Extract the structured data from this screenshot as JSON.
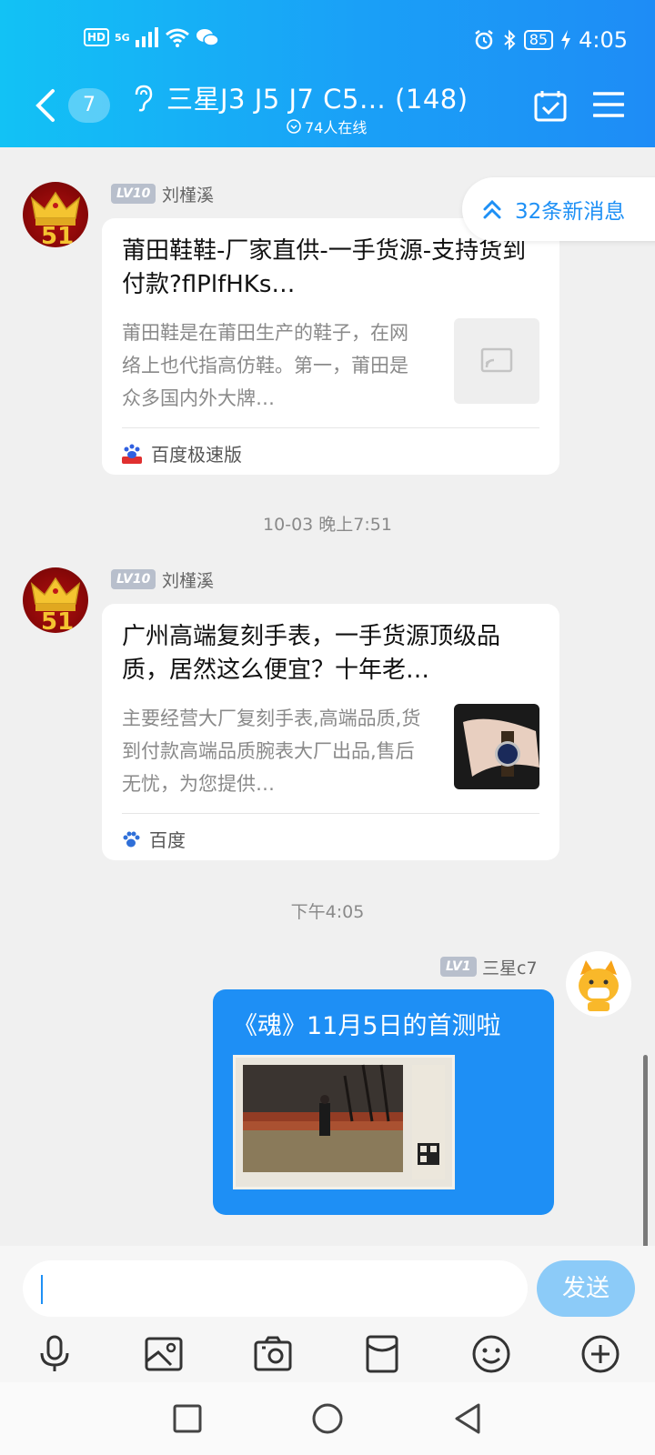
{
  "status_bar": {
    "network_hd": "HD",
    "network_5g": "5G",
    "battery": "85",
    "time": "4:05"
  },
  "header": {
    "back_count": "7",
    "title": "三星J3 J5 J7 C5… (148)",
    "online": "74人在线"
  },
  "new_messages": "32条新消息",
  "messages": [
    {
      "level": "LV10",
      "sender": "刘槿溪",
      "card_title": "莆田鞋鞋-厂家直供-一手货源-支持货到付款?flPlfHKs…",
      "card_desc": "莆田鞋是在莆田生产的鞋子，在网络上也代指高仿鞋。第一，莆田是众多国内外大牌…",
      "source": "百度极速版"
    },
    {
      "timestamp": "10-03 晚上7:51",
      "level": "LV10",
      "sender": "刘槿溪",
      "card_title": "广州高端复刻手表，一手货源顶级品质，居然这么便宜？十年老…",
      "card_desc": "主要经营大厂复刻手表,高端品质,货到付款高端品质腕表大厂出品,售后无忧，为您提供…",
      "source": "百度"
    },
    {
      "timestamp": "下午4:05",
      "level": "LV1",
      "sender": "三星c7",
      "text": "《魂》11月5日的首测啦"
    }
  ],
  "input": {
    "send_label": "发送",
    "value": ""
  },
  "toolbar_icons": [
    "microphone-icon",
    "image-icon",
    "camera-icon",
    "red-packet-icon",
    "emoji-icon",
    "plus-icon"
  ],
  "nav_icons": [
    "recent-apps-icon",
    "home-icon",
    "back-icon"
  ],
  "colors": {
    "header_start": "#12c2f5",
    "header_end": "#1e8cf6",
    "my_bubble": "#1e8ff5",
    "accent": "#1e90f5",
    "send_disabled": "#8ccbf8"
  }
}
